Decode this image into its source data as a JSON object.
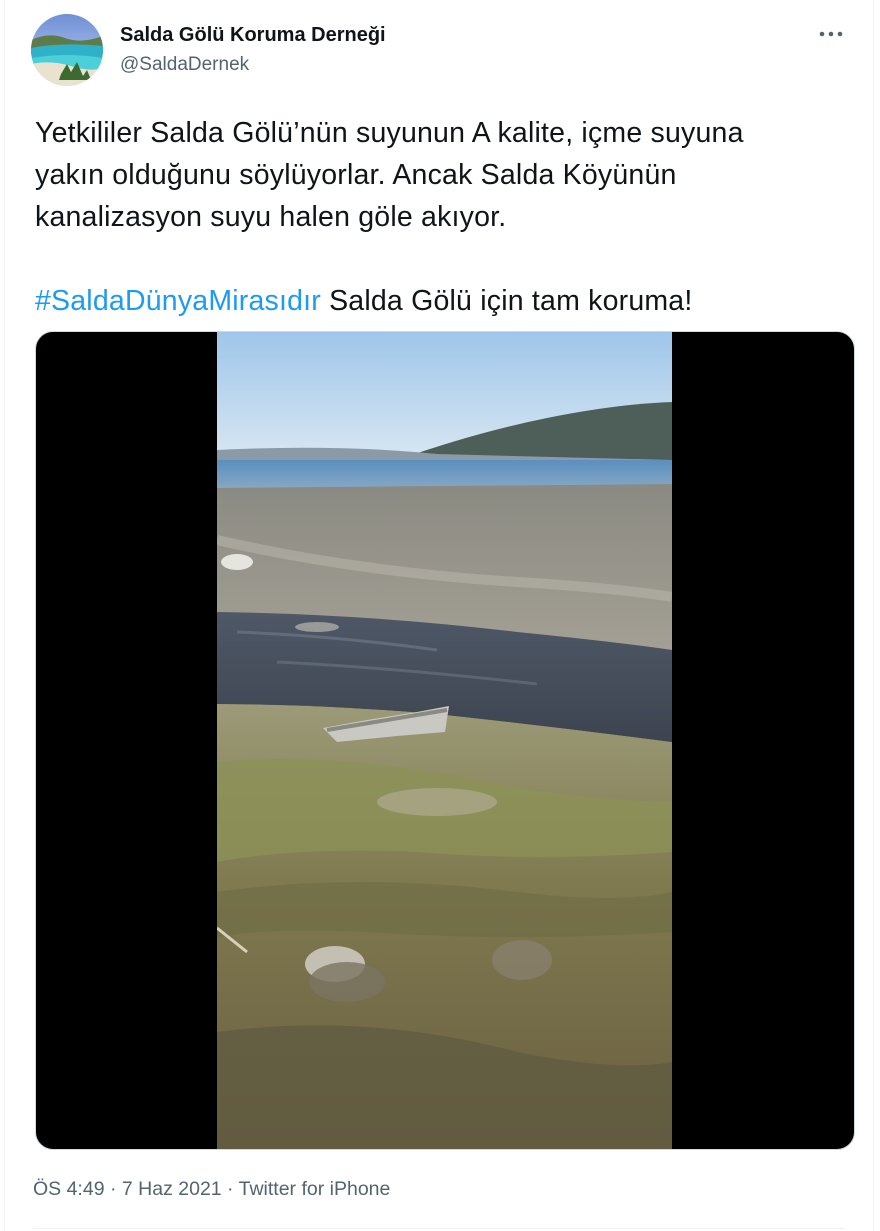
{
  "author": {
    "display_name": "Salda Gölü Koruma Derneği",
    "handle": "@SaldaDernek",
    "avatar_icon": "lake-landscape-avatar"
  },
  "more_icon": "ellipsis-icon",
  "tweet": {
    "line1": "Yetkililer Salda Gölü’nün suyunun A kalite, içme suyuna",
    "line2": "yakın olduğunu söylüyorlar. Ancak Salda Köyünün",
    "line3": "kanalizasyon suyu halen göle akıyor.",
    "hashtag": "#SaldaDünyaMirasıdır",
    "after_hashtag": " Salda Gölü için tam koruma!"
  },
  "media": {
    "type": "video-thumbnail"
  },
  "meta": {
    "time": "ÖS 4:49",
    "sep1": " · ",
    "date": "7 Haz 2021",
    "sep2": " · ",
    "source": "Twitter for iPhone"
  },
  "colors": {
    "link": "#1d9bf0",
    "text": "#0f1419",
    "secondary": "#536471"
  }
}
